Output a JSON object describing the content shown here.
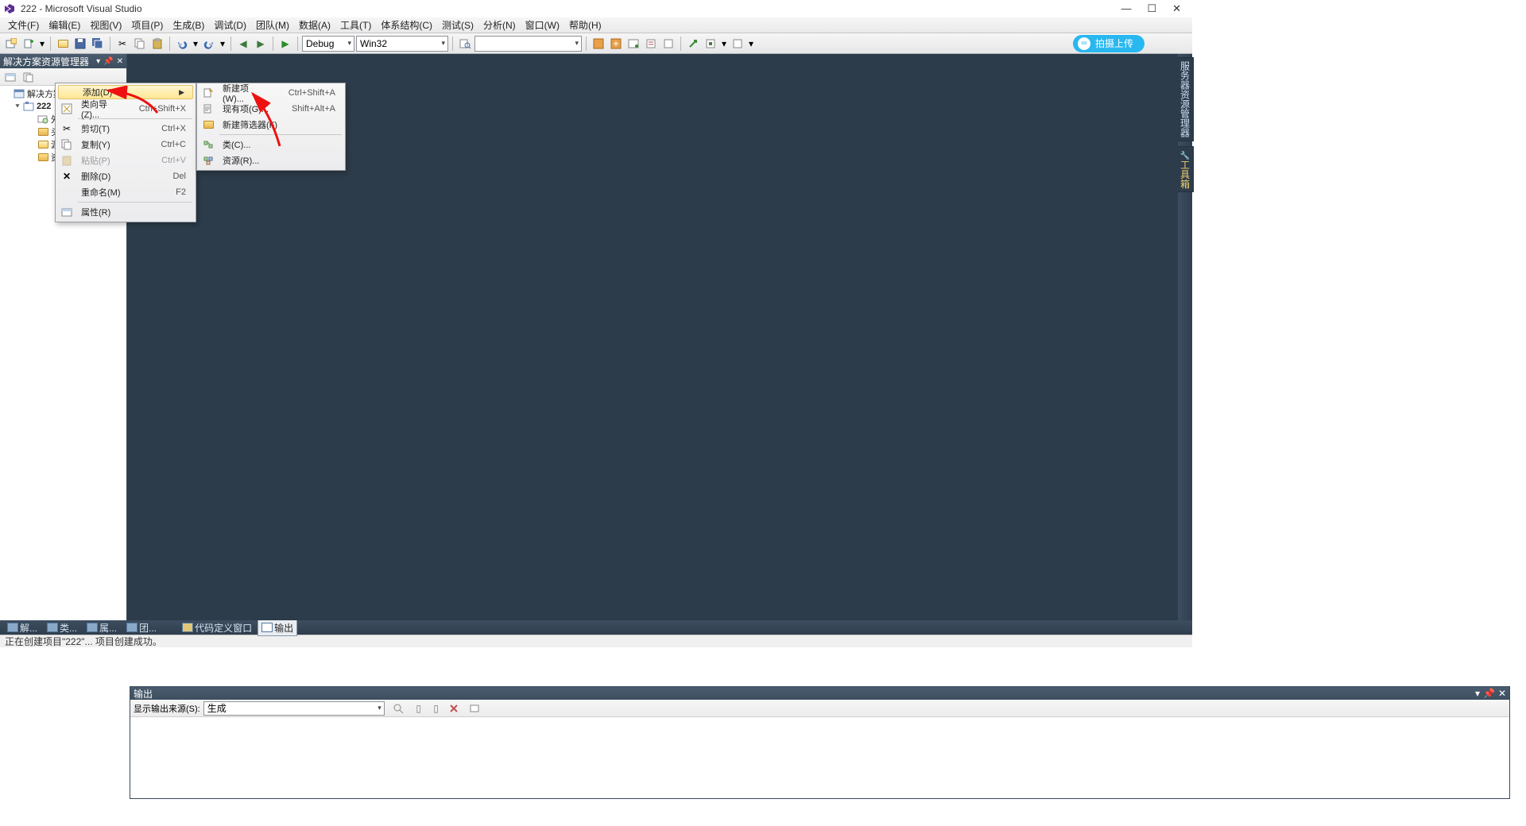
{
  "title": "222 - Microsoft Visual Studio",
  "menu": [
    "文件(F)",
    "编辑(E)",
    "视图(V)",
    "项目(P)",
    "生成(B)",
    "调试(D)",
    "团队(M)",
    "数据(A)",
    "工具(T)",
    "体系结构(C)",
    "测试(S)",
    "分析(N)",
    "窗口(W)",
    "帮助(H)"
  ],
  "toolbar": {
    "config": "Debug",
    "platform": "Win32",
    "upload": "拍摄上传"
  },
  "solutionExplorer": {
    "title": "解决方案资源管理器",
    "solution": "解决方案\"222\"(1 个项目)",
    "project": "222",
    "nodes": [
      "外部依赖项",
      "头文件",
      "源文件",
      "资源文件"
    ]
  },
  "ctxMain": {
    "add": "添加(D)",
    "wizard": "类向导(Z)...",
    "wizardSc": "Ctrl+Shift+X",
    "cut": "剪切(T)",
    "cutSc": "Ctrl+X",
    "copy": "复制(Y)",
    "copySc": "Ctrl+C",
    "paste": "粘贴(P)",
    "pasteSc": "Ctrl+V",
    "del": "删除(D)",
    "delSc": "Del",
    "rename": "重命名(M)",
    "renameSc": "F2",
    "props": "属性(R)"
  },
  "ctxSub": {
    "newItem": "新建项(W)...",
    "newItemSc": "Ctrl+Shift+A",
    "existing": "现有项(G)...",
    "existingSc": "Shift+Alt+A",
    "newFilter": "新建筛选器(F)",
    "cls": "类(C)...",
    "res": "资源(R)..."
  },
  "output": {
    "title": "输出",
    "srcLabel": "显示输出来源(S):",
    "src": "生成"
  },
  "rightTabs": [
    "服务器资源管理器",
    "工具箱"
  ],
  "bottomTabs": {
    "l": [
      "解...",
      "类...",
      "属...",
      "团..."
    ],
    "r": [
      "代码定义窗口",
      "输出"
    ]
  },
  "status": "正在创建项目\"222\"... 项目创建成功。"
}
